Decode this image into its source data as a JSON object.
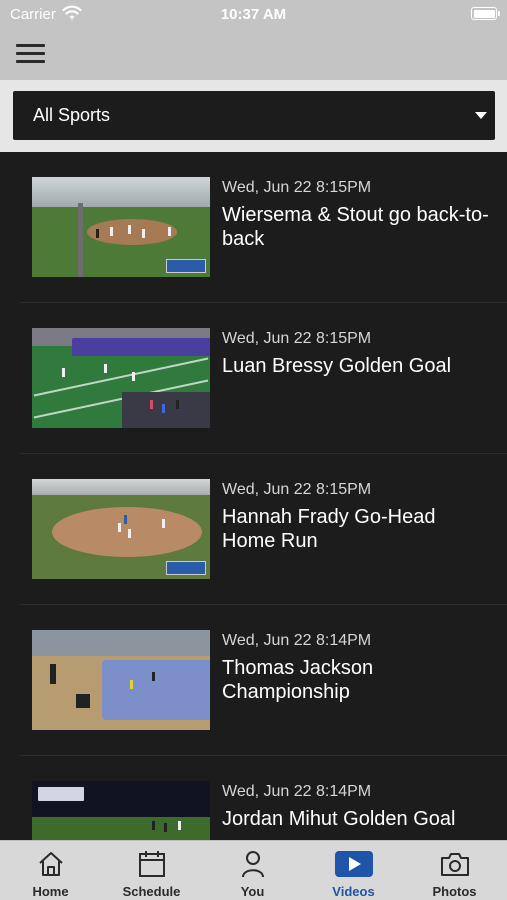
{
  "status_bar": {
    "carrier": "Carrier",
    "time": "10:37 AM"
  },
  "filter": {
    "selected": "All Sports"
  },
  "videos": [
    {
      "date": "Wed, Jun 22 8:15PM",
      "title": "Wiersema & Stout go back-to-back",
      "thumb": "baseball field"
    },
    {
      "date": "Wed, Jun 22 8:15PM",
      "title": "Luan Bressy Golden Goal",
      "thumb": "soccer field"
    },
    {
      "date": "Wed, Jun 22 8:15PM",
      "title": "Hannah Frady Go-Head Home Run",
      "thumb": "softball field"
    },
    {
      "date": "Wed, Jun 22 8:14PM",
      "title": "Thomas Jackson Championship",
      "thumb": "indoor track"
    },
    {
      "date": "Wed, Jun 22 8:14PM",
      "title": "Jordan Mihut Golden Goal",
      "thumb": "soccer field night"
    }
  ],
  "tabs": [
    {
      "label": "Home",
      "icon": "home-icon"
    },
    {
      "label": "Schedule",
      "icon": "calendar-icon"
    },
    {
      "label": "You",
      "icon": "person-icon"
    },
    {
      "label": "Videos",
      "icon": "play-icon",
      "active": true
    },
    {
      "label": "Photos",
      "icon": "camera-icon"
    }
  ],
  "colors": {
    "accent": "#1f54a8",
    "background": "#1c1c1c",
    "bar": "#c4c4c4"
  }
}
